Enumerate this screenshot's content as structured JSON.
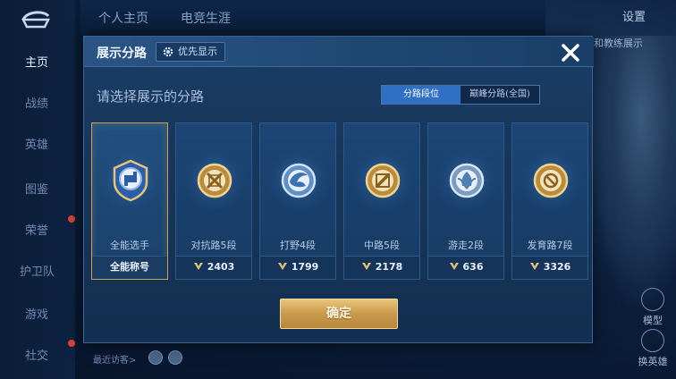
{
  "nav": {
    "items": [
      "主页",
      "战绩",
      "英雄",
      "图鉴",
      "荣誉",
      "护卫队",
      "游戏",
      "社交"
    ],
    "active_index": 0
  },
  "top_tabs": [
    "个人主页",
    "电竞生涯"
  ],
  "settings_label": "设置",
  "bg_link": "和教练展示",
  "side_actions": [
    "模型",
    "换英雄"
  ],
  "visitors_label": "最近访客>",
  "modal": {
    "title": "展示分路",
    "priority_label": "优先显示",
    "prompt": "请选择展示的分路",
    "toggle": [
      "分路段位",
      "巅峰分路(全国)"
    ],
    "toggle_active": 0,
    "cards": [
      {
        "role": "全能选手",
        "score": "全能称号",
        "emblem": "all-round-emblem",
        "selected": true
      },
      {
        "role": "对抗路5段",
        "score": "2403",
        "emblem": "clash-lane-emblem",
        "selected": false
      },
      {
        "role": "打野4段",
        "score": "1799",
        "emblem": "jungle-emblem",
        "selected": false
      },
      {
        "role": "中路5段",
        "score": "2178",
        "emblem": "mid-lane-emblem",
        "selected": false
      },
      {
        "role": "游走2段",
        "score": "636",
        "emblem": "roam-emblem",
        "selected": false
      },
      {
        "role": "发育路7段",
        "score": "3326",
        "emblem": "farm-lane-emblem",
        "selected": false
      }
    ],
    "confirm_label": "确定"
  },
  "colors": {
    "accent_gold": "#c9a25a",
    "toggle_active": "#2f6fc4",
    "modal_bg": "#173558"
  }
}
